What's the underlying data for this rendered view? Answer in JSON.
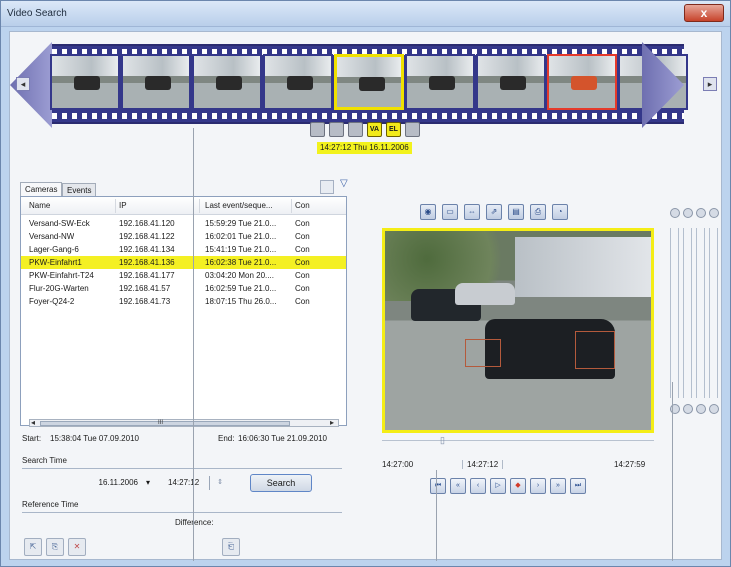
{
  "window": {
    "title": "Video Search",
    "close_label": "x"
  },
  "filmstrip": {
    "left_arrow": "◂",
    "right_arrow": "▸",
    "frames": [
      {
        "selected": ""
      },
      {
        "selected": ""
      },
      {
        "selected": ""
      },
      {
        "selected": ""
      },
      {
        "selected": "yellow"
      },
      {
        "selected": ""
      },
      {
        "selected": ""
      },
      {
        "selected": "red"
      },
      {
        "selected": ""
      }
    ],
    "buttons": [
      "",
      "",
      "",
      "VA",
      "EL",
      ""
    ],
    "timestamp": "14:27:12 Thu 16.11.2006"
  },
  "tabs": {
    "cameras": "Cameras",
    "events": "Events"
  },
  "table": {
    "headers": [
      "Name",
      "IP",
      "Last event/seque...",
      "Con"
    ],
    "rows": [
      {
        "name": "Versand-SW-Eck",
        "ip": "192.168.41.120",
        "last": "15:59:29 Tue 21.0...",
        "con": "Con"
      },
      {
        "name": "Versand-NW",
        "ip": "192.168.41.122",
        "last": "16:02:01 Tue 21.0...",
        "con": "Con"
      },
      {
        "name": "Lager-Gang-6",
        "ip": "192.168.41.134",
        "last": "15:41:19 Tue 21.0...",
        "con": "Con"
      },
      {
        "name": "PKW-Einfahrt1",
        "ip": "192.168.41.136",
        "last": "16:02:38 Tue 21.0...",
        "con": "Con"
      },
      {
        "name": "PKW-Einfahrt-T24",
        "ip": "192.168.41.177",
        "last": "03:04:20 Mon 20....",
        "con": "Con"
      },
      {
        "name": "Flur-20G-Warten",
        "ip": "192.168.41.57",
        "last": "16:02:59 Tue 21.0...",
        "con": "Con"
      },
      {
        "name": "Foyer-Q24-2",
        "ip": "192.168.41.73",
        "last": "18:07:15 Thu 26.0...",
        "con": "Con"
      }
    ],
    "selected_index": 3,
    "scroll_mark": "III",
    "scroll_left": "◂",
    "scroll_right": "▸"
  },
  "range": {
    "start_label": "Start:",
    "start_value": "15:38:04 Tue 07.09.2010",
    "end_label": "End:",
    "end_value": "16:06:30 Tue 21.09.2010"
  },
  "search": {
    "section_label": "Search Time",
    "date_value": "16.11.2006",
    "dropdown_arrow": "▾",
    "time_value": "14:27:12",
    "spin_arrows": "⇕",
    "search_button": "Search"
  },
  "reference": {
    "section_label": "Reference Time",
    "difference_label": "Difference:"
  },
  "bottom_buttons": [
    "⇱",
    "⎘",
    "✕",
    "⎗"
  ],
  "video": {
    "toolbar": [
      "◉",
      "▭",
      "⇔",
      "⇗",
      "▤",
      "⎙",
      "◔"
    ],
    "slider_knob": "▯",
    "time_start": "14:27:00",
    "time_mid": "14:27:12",
    "time_end": "14:27:59",
    "playback": [
      "⏮",
      "«",
      "‹",
      "▷",
      "◆",
      "›",
      "»",
      "⏭"
    ]
  },
  "filter_icon": "▽"
}
